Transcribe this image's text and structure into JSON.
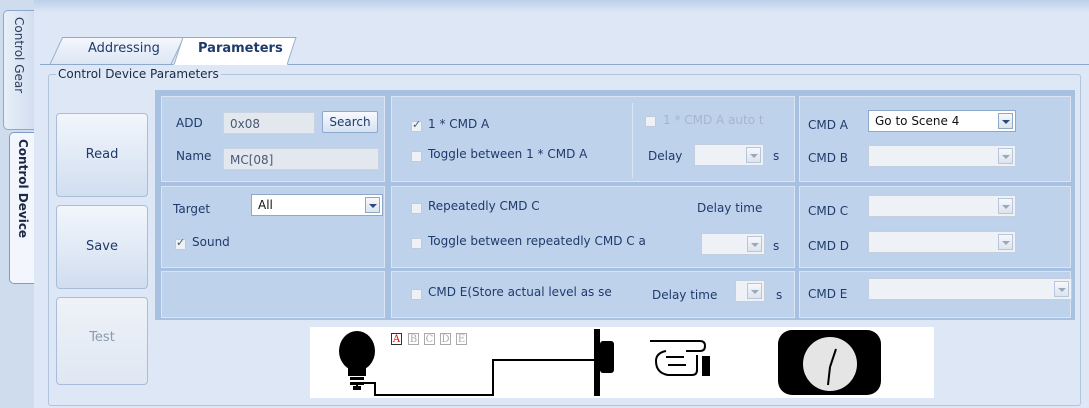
{
  "vertical_tabs": [
    {
      "label": "Control Gear"
    },
    {
      "label": "Control Device"
    }
  ],
  "tabs": [
    {
      "label": "Addressing"
    },
    {
      "label": "Parameters"
    }
  ],
  "group_title": "Control Device Parameters",
  "buttons": {
    "read": "Read",
    "save": "Save",
    "test": "Test",
    "search": "Search"
  },
  "address": {
    "add_label": "ADD",
    "add_value": "0x08",
    "name_label": "Name",
    "name_value": "MC[08]"
  },
  "target": {
    "label": "Target",
    "value": "All"
  },
  "sound": {
    "label": "Sound",
    "checked": true
  },
  "options": {
    "cmd_a_once": {
      "label": "1 * CMD A",
      "checked": true
    },
    "cmd_a_auto": {
      "label": "1 * CMD A auto t",
      "checked": false
    },
    "toggle_a": {
      "label": "Toggle between 1 * CMD A",
      "checked": false
    },
    "delay_label": "Delay",
    "unit_s": "s",
    "repeat_c": {
      "label": "Repeatedly CMD C",
      "checked": false
    },
    "delay_time_label": "Delay time",
    "toggle_c": {
      "label": "Toggle between repeatedly CMD C a",
      "checked": false
    },
    "cmd_e": {
      "label": "CMD E(Store actual level as se",
      "checked": false
    }
  },
  "commands": {
    "cmd_a": {
      "label": "CMD A",
      "value": "Go to Scene 4"
    },
    "cmd_b": {
      "label": "CMD B",
      "value": ""
    },
    "cmd_c": {
      "label": "CMD C",
      "value": ""
    },
    "cmd_d": {
      "label": "CMD D",
      "value": ""
    },
    "cmd_e": {
      "label": "CMD E",
      "value": ""
    }
  },
  "diagram": {
    "letters": [
      "A",
      "B",
      "C",
      "D",
      "E"
    ],
    "active_letter": "A"
  },
  "colors": {
    "panel_bg": "#dde7f5",
    "cell_bg": "#bfd2ec",
    "accent_border": "#8ea8cc",
    "active_letter": "#dd0000"
  }
}
